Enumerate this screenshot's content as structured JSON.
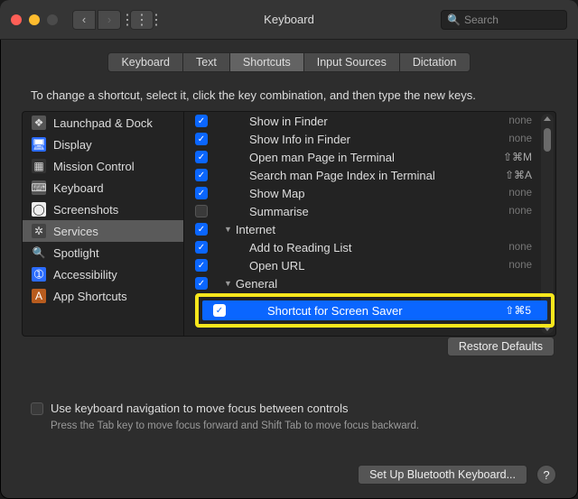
{
  "window": {
    "title": "Keyboard",
    "search_placeholder": "Search"
  },
  "tabs": [
    "Keyboard",
    "Text",
    "Shortcuts",
    "Input Sources",
    "Dictation"
  ],
  "active_tab_index": 2,
  "instructions": "To change a shortcut, select it, click the key combination, and then type the new keys.",
  "sidebar": {
    "items": [
      {
        "label": "Launchpad & Dock",
        "icon": "launchpad-icon",
        "glyph": "❖",
        "bg": "#555",
        "fg": "#ddd"
      },
      {
        "label": "Display",
        "icon": "display-icon",
        "glyph": "🖥",
        "bg": "#2b6cff",
        "fg": "#fff"
      },
      {
        "label": "Mission Control",
        "icon": "mission-control-icon",
        "glyph": "▦",
        "bg": "#333",
        "fg": "#ddd"
      },
      {
        "label": "Keyboard",
        "icon": "keyboard-icon",
        "glyph": "⌨",
        "bg": "#555",
        "fg": "#ddd"
      },
      {
        "label": "Screenshots",
        "icon": "screenshots-icon",
        "glyph": "◯",
        "bg": "#eee",
        "fg": "#333"
      },
      {
        "label": "Services",
        "icon": "services-icon",
        "glyph": "✲",
        "bg": "#444",
        "fg": "#ddd"
      },
      {
        "label": "Spotlight",
        "icon": "spotlight-icon",
        "glyph": "🔍",
        "bg": "transparent",
        "fg": "#ddd"
      },
      {
        "label": "Accessibility",
        "icon": "accessibility-icon",
        "glyph": "➀",
        "bg": "#2b6cff",
        "fg": "#fff"
      },
      {
        "label": "App Shortcuts",
        "icon": "app-shortcuts-icon",
        "glyph": "A",
        "bg": "#b85c1e",
        "fg": "#fff"
      }
    ],
    "selected_index": 5
  },
  "shortcuts": {
    "visible_rows": [
      {
        "type": "item",
        "checked": true,
        "label": "Show in Finder",
        "shortcut": "none"
      },
      {
        "type": "item",
        "checked": true,
        "label": "Show Info in Finder",
        "shortcut": "none"
      },
      {
        "type": "item",
        "checked": true,
        "label": "Open man Page in Terminal",
        "shortcut": "⇧⌘M"
      },
      {
        "type": "item",
        "checked": true,
        "label": "Search man Page Index in Terminal",
        "shortcut": "⇧⌘A"
      },
      {
        "type": "item",
        "checked": true,
        "label": "Show Map",
        "shortcut": "none"
      },
      {
        "type": "item",
        "checked": false,
        "label": "Summarise",
        "shortcut": "none"
      },
      {
        "type": "group",
        "checked": true,
        "label": "Internet"
      },
      {
        "type": "item",
        "checked": true,
        "label": "Add to Reading List",
        "shortcut": "none"
      },
      {
        "type": "item",
        "checked": true,
        "label": "Open URL",
        "shortcut": "none"
      },
      {
        "type": "group",
        "checked": true,
        "label": "General"
      }
    ],
    "selected": {
      "label": "Shortcut for Screen Saver",
      "shortcut": "⇧⌘5",
      "checked": true
    }
  },
  "buttons": {
    "restore": "Restore Defaults",
    "bluetooth": "Set Up Bluetooth Keyboard...",
    "help": "?"
  },
  "footer": {
    "checkbox_label": "Use keyboard navigation to move focus between controls",
    "hint": "Press the Tab key to move focus forward and Shift Tab to move focus backward."
  }
}
